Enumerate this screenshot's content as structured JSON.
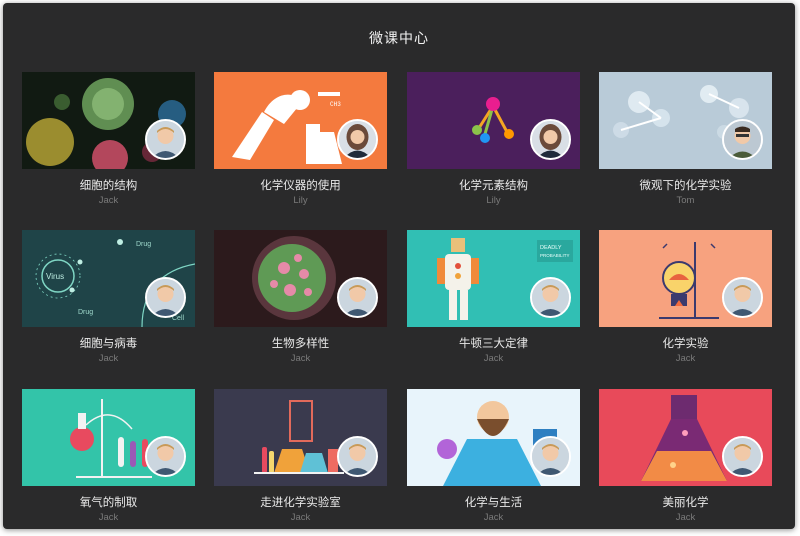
{
  "page": {
    "title": "微课中心"
  },
  "courses": [
    {
      "title": "细胞的结构",
      "teacher": "Jack",
      "art": "cell",
      "bg": "#111a12",
      "avatar": "jack"
    },
    {
      "title": "化学仪器的使用",
      "teacher": "Lily",
      "art": "instrument",
      "bg": "#f47a3e",
      "avatar": "lily"
    },
    {
      "title": "化学元素结构",
      "teacher": "Lily",
      "art": "molecule",
      "bg": "#4b1f5c",
      "avatar": "lily"
    },
    {
      "title": "微观下的化学实验",
      "teacher": "Tom",
      "art": "micro",
      "bg": "#b9cbd8",
      "avatar": "tom"
    },
    {
      "title": "细胞与病毒",
      "teacher": "Jack",
      "art": "virus",
      "bg": "#1f4448",
      "avatar": "jack",
      "labels": [
        "Virus",
        "Drug",
        "Drug",
        "Cell"
      ]
    },
    {
      "title": "生物多样性",
      "teacher": "Jack",
      "art": "bio",
      "bg": "#2c1a1c",
      "avatar": "jack"
    },
    {
      "title": "牛顿三大定律",
      "teacher": "Jack",
      "art": "newton",
      "bg": "#31bfb4",
      "avatar": "jack",
      "labels": [
        "DEADLY",
        "PROBABILITY"
      ]
    },
    {
      "title": "化学实验",
      "teacher": "Jack",
      "art": "lab",
      "bg": "#f7a27f",
      "avatar": "jack"
    },
    {
      "title": "氧气的制取",
      "teacher": "Jack",
      "art": "oxygen",
      "bg": "#33c4a9",
      "avatar": "jack"
    },
    {
      "title": "走进化学实验室",
      "teacher": "Jack",
      "art": "labroom",
      "bg": "#3a3a4e",
      "avatar": "jack"
    },
    {
      "title": "化学与生活",
      "teacher": "Jack",
      "art": "life",
      "bg": "#e8f4fb",
      "avatar": "jack"
    },
    {
      "title": "美丽化学",
      "teacher": "Jack",
      "art": "flask",
      "bg": "#e84a5a",
      "avatar": "jack"
    }
  ]
}
